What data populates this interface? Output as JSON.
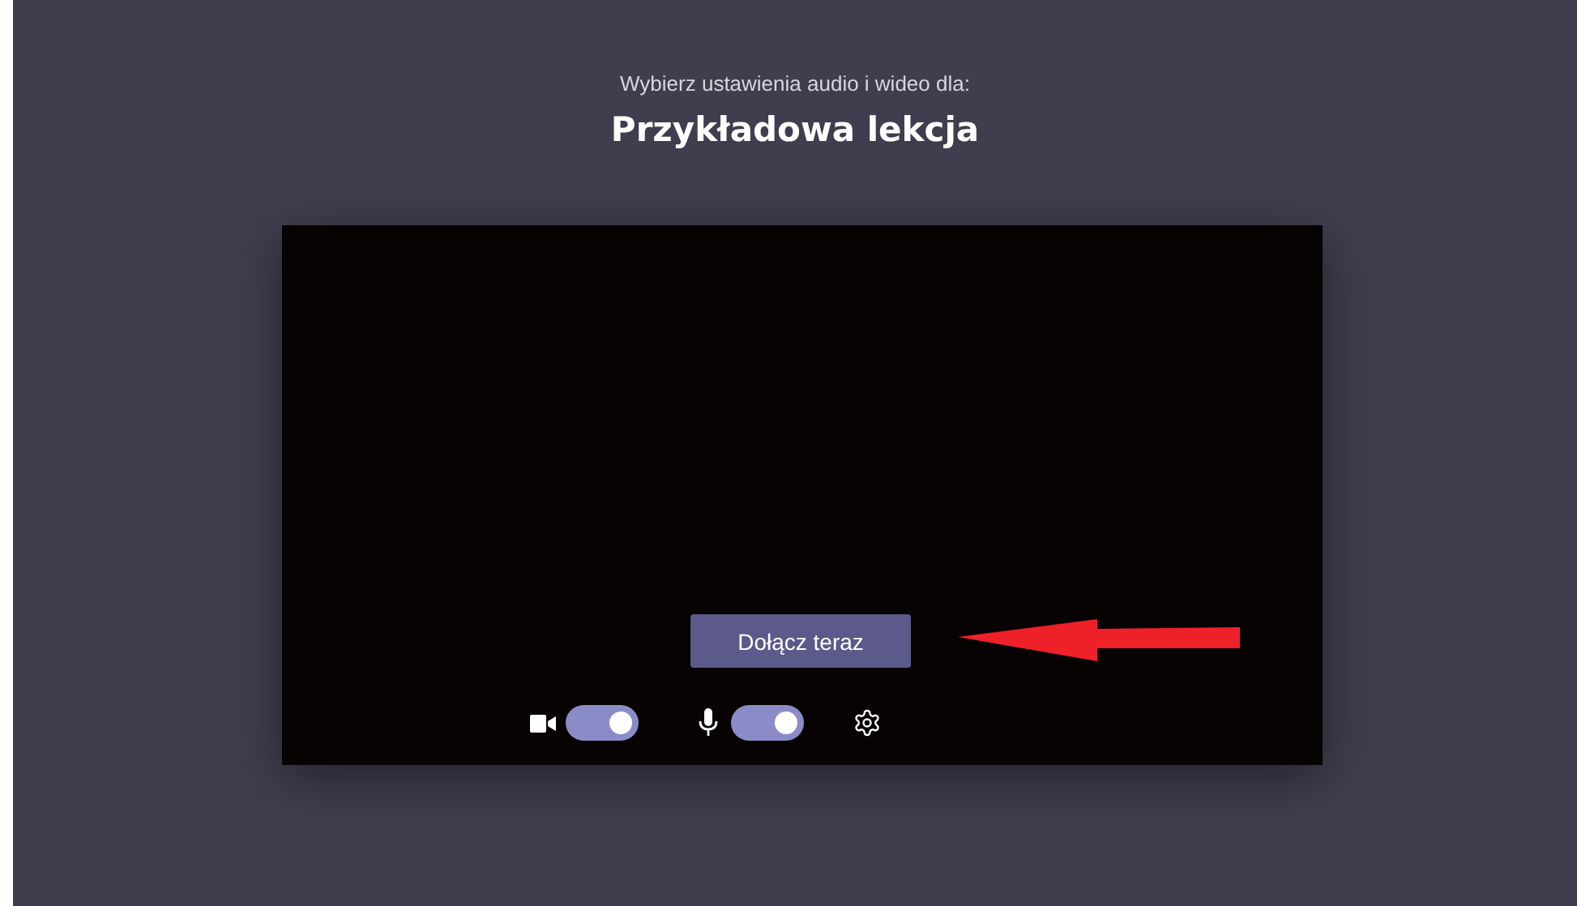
{
  "header": {
    "subtitle": "Wybierz ustawienia audio i wideo dla:",
    "title": "Przykładowa lekcja"
  },
  "preview": {
    "join_button": "Dołącz teraz",
    "camera": {
      "on": true
    },
    "microphone": {
      "on": true
    }
  }
}
